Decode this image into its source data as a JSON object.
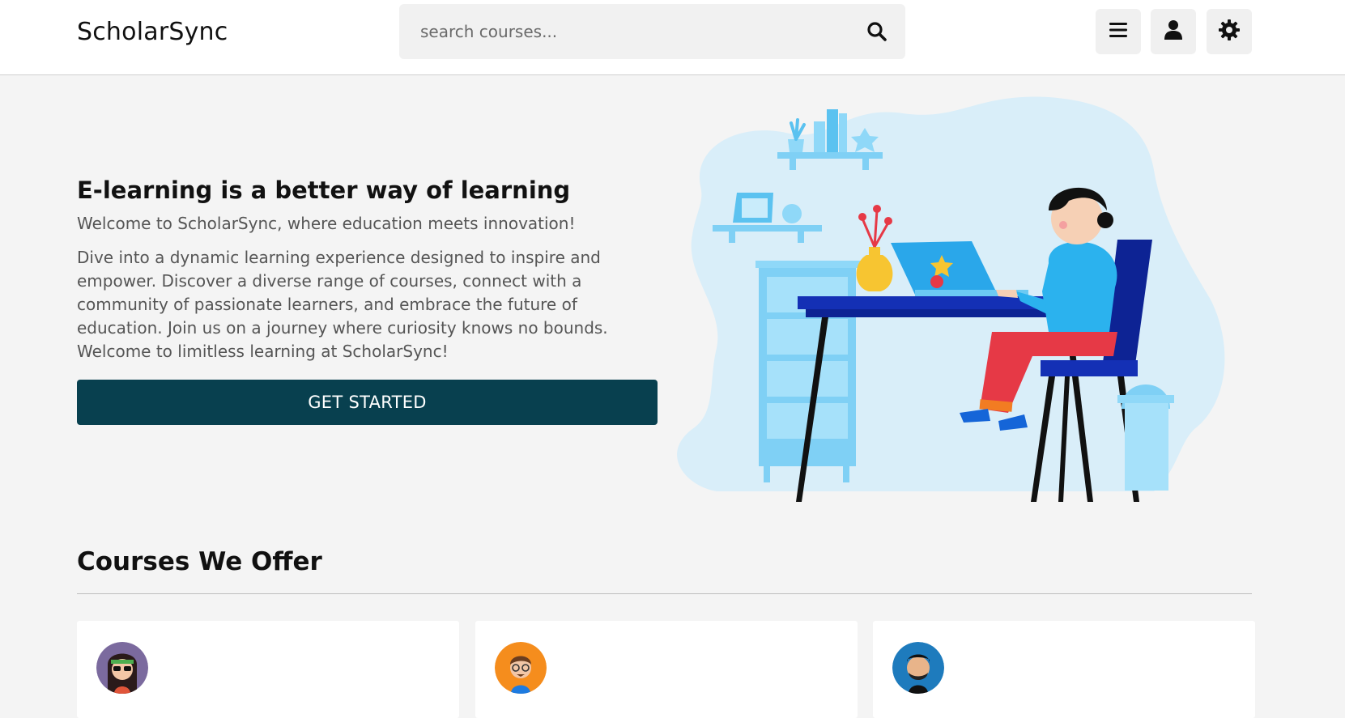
{
  "header": {
    "logo": "ScholarSync",
    "search_placeholder": "search courses...",
    "icons": [
      "search-icon",
      "menu-icon",
      "user-icon",
      "gear-icon"
    ]
  },
  "hero": {
    "title": "E-learning is a better way of learning",
    "subtitle": "Welcome to ScholarSync, where education meets innovation!",
    "description": "Dive into a dynamic learning experience designed to inspire and empower. Discover a diverse range of courses, connect with a community of passionate learners, and embrace the future of education. Join us on a journey where curiosity knows no bounds. Welcome to limitless learning at ScholarSync!",
    "cta_label": "GET STARTED"
  },
  "courses": {
    "title": "Courses We Offer"
  },
  "colors": {
    "accent": "#08404f",
    "background": "#f4f4f4",
    "illustration_blob": "#d9eef9"
  }
}
